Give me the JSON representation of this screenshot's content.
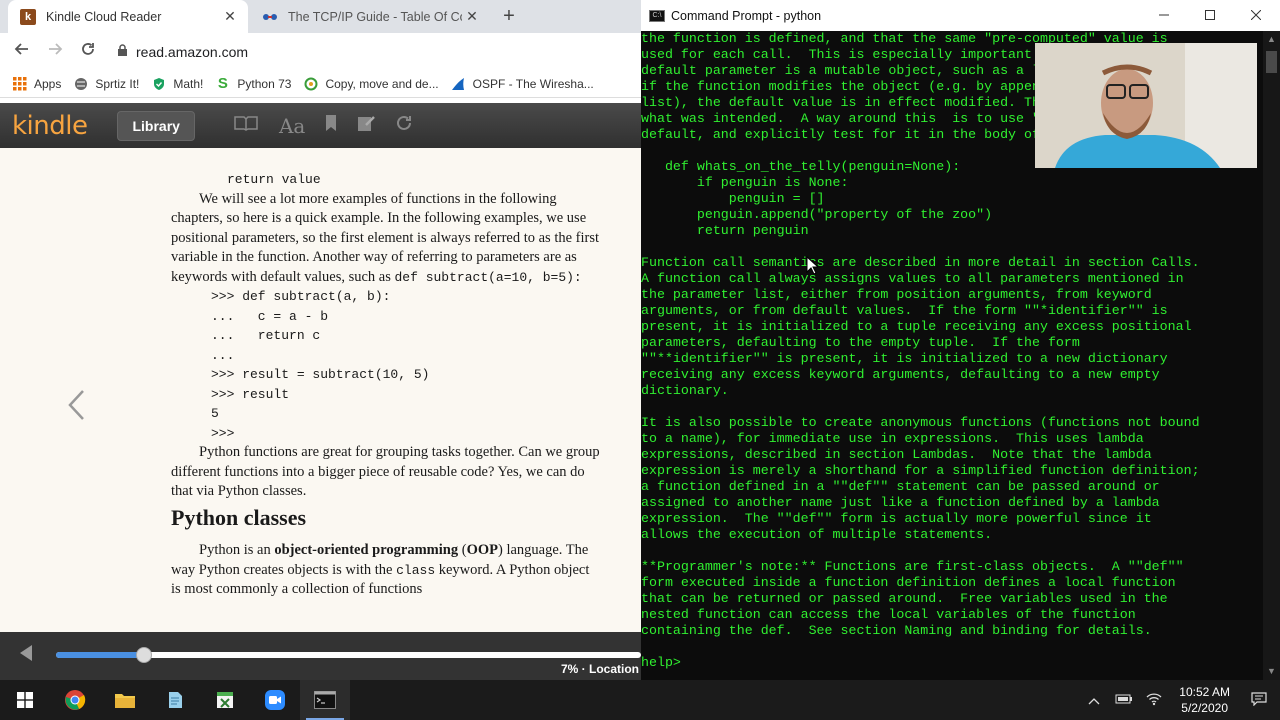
{
  "chrome": {
    "tabs": [
      {
        "label": "Kindle Cloud Reader",
        "favicon": "kindle-k-icon",
        "close": "✕"
      },
      {
        "label": "The TCP/IP Guide - Table Of Contents",
        "favicon": "tcpip-guide-icon",
        "close": "✕"
      }
    ],
    "new_tab": "+",
    "url": "read.amazon.com",
    "bookmarks": [
      "Apps",
      "Sprtiz It!",
      "Math!",
      "Python 73",
      "Copy, move and de...",
      "OSPF - The Wiresha..."
    ]
  },
  "kindle": {
    "logo": "kindle",
    "library_label": "Library",
    "page": {
      "code_top": "return value",
      "para1": "We will see a lot more examples of functions in the following chapters, so here is a quick example. In the following examples, we use positional parameters, so the first element is always referred to as the first variable in the function. Another way of referring to parameters are as keywords with default values, such as",
      "para1_code": "def subtract(a=10, b=5):",
      "code_lines": [
        ">>> def subtract(a, b):",
        "...   c = a - b",
        "...   return c",
        "...",
        ">>> result = subtract(10, 5)",
        ">>> result",
        "5",
        ">>>"
      ],
      "para2": "Python functions are great for grouping tasks together. Can we group different functions into a bigger piece of reusable code? Yes, we can do that via Python classes.",
      "heading": "Python classes",
      "para3_a": "Python is an",
      "para3_bold": "object-oriented programming",
      "para3_b": "(",
      "para3_bold2": "OOP",
      "para3_c": ") language. The way Python creates objects is with the",
      "para3_code": "class",
      "para3_d": "keyword. A Python object is most commonly a collection of functions"
    },
    "progress_fraction": 0.15,
    "location_text": "7% · Location"
  },
  "cmd": {
    "title": "Command Prompt - python",
    "lines": [
      "the function is defined, and that the same \"pre-computed\" value is",
      "used for each call.  This is especially important to u",
      "default parameter is a mutable object, such as a list",
      "if the function modifies the object (e.g. by appending",
      "list), the default value is in effect modified. This i",
      "what was intended.  A way around this  is to use \"None",
      "default, and explicitly test for it in the body of the",
      "",
      "   def whats_on_the_telly(penguin=None):",
      "       if penguin is None:",
      "           penguin = []",
      "       penguin.append(\"property of the zoo\")",
      "       return penguin",
      "",
      "Function call semantics are described in more detail in section Calls.",
      "A function call always assigns values to all parameters mentioned in",
      "the parameter list, either from position arguments, from keyword",
      "arguments, or from default values.  If the form \"\"*identifier\"\" is",
      "present, it is initialized to a tuple receiving any excess positional",
      "parameters, defaulting to the empty tuple.  If the form",
      "\"\"**identifier\"\" is present, it is initialized to a new dictionary",
      "receiving any excess keyword arguments, defaulting to a new empty",
      "dictionary.",
      "",
      "It is also possible to create anonymous functions (functions not bound",
      "to a name), for immediate use in expressions.  This uses lambda",
      "expressions, described in section Lambdas.  Note that the lambda",
      "expression is merely a shorthand for a simplified function definition;",
      "a function defined in a \"\"def\"\" statement can be passed around or",
      "assigned to another name just like a function defined by a lambda",
      "expression.  The \"\"def\"\" form is actually more powerful since it",
      "allows the execution of multiple statements.",
      "",
      "**Programmer's note:** Functions are first-class objects.  A \"\"def\"\"",
      "form executed inside a function definition defines a local function",
      "that can be returned or passed around.  Free variables used in the",
      "nested function can access the local variables of the function",
      "containing the def.  See section Naming and binding for details.",
      "",
      "help> "
    ],
    "text_color": "#30f030"
  },
  "taskbar": {
    "time": "10:52 AM",
    "date": "5/2/2020"
  }
}
